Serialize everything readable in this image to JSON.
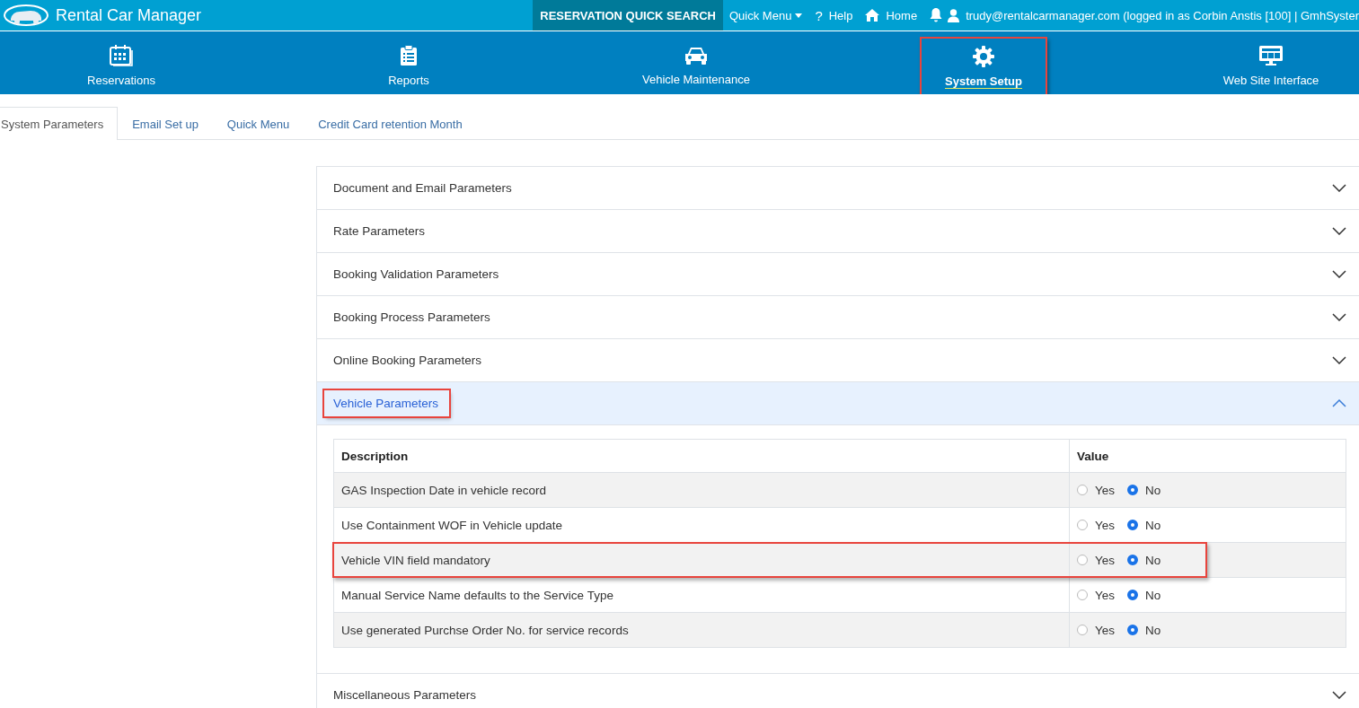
{
  "top_bar": {
    "app_title": "Rental Car Manager",
    "quick_search": "RESERVATION QUICK SEARCH",
    "links": [
      {
        "kind": "menu",
        "label": "Quick Menu"
      },
      {
        "kind": "help",
        "icon": "?",
        "label": "Help"
      },
      {
        "kind": "home",
        "label": "Home"
      },
      {
        "kind": "bell"
      },
      {
        "kind": "user",
        "label": "trudy@rentalcarmanager.com (logged in as Corbin Anstis [100] | GmhSyster"
      }
    ]
  },
  "nav": [
    {
      "kind": "calendar",
      "label": "Reservations",
      "selected": false,
      "highlighted": false
    },
    {
      "kind": "clipboard",
      "label": "Reports",
      "selected": false,
      "highlighted": false
    },
    {
      "kind": "car",
      "label": "Vehicle Maintenance",
      "selected": false,
      "highlighted": false
    },
    {
      "kind": "gear",
      "label": "System Setup",
      "selected": true,
      "highlighted": true
    },
    {
      "kind": "monitor",
      "label": "Web Site Interface",
      "selected": false,
      "highlighted": false
    }
  ],
  "tabs": [
    {
      "label": "System Parameters",
      "selected": true
    },
    {
      "label": "Email Set up",
      "selected": false
    },
    {
      "label": "Quick Menu",
      "selected": false
    },
    {
      "label": "Credit Card retention Month",
      "selected": false
    }
  ],
  "sections": [
    {
      "title": "Document and Email Parameters",
      "expanded": false,
      "highlighted": false
    },
    {
      "title": "Rate Parameters",
      "expanded": false,
      "highlighted": false
    },
    {
      "title": "Booking Validation Parameters",
      "expanded": false,
      "highlighted": false
    },
    {
      "title": "Booking Process Parameters",
      "expanded": false,
      "highlighted": false
    },
    {
      "title": "Online Booking Parameters",
      "expanded": false,
      "highlighted": false
    },
    {
      "title": "Vehicle Parameters",
      "expanded": true,
      "highlighted": true,
      "table": {
        "columns": [
          "Description",
          "Value"
        ],
        "rows": [
          {
            "description": "GAS Inspection Date in vehicle record",
            "options": [
              {
                "label": "Yes",
                "selected": false
              },
              {
                "label": "No",
                "selected": true
              }
            ],
            "highlighted": false
          },
          {
            "description": "Use Containment WOF in Vehicle update",
            "options": [
              {
                "label": "Yes",
                "selected": false
              },
              {
                "label": "No",
                "selected": true
              }
            ],
            "highlighted": false
          },
          {
            "description": "Vehicle VIN field mandatory",
            "options": [
              {
                "label": "Yes",
                "selected": false
              },
              {
                "label": "No",
                "selected": true
              }
            ],
            "highlighted": true
          },
          {
            "description": "Manual Service Name defaults to the Service Type",
            "options": [
              {
                "label": "Yes",
                "selected": false
              },
              {
                "label": "No",
                "selected": true
              }
            ],
            "highlighted": false
          },
          {
            "description": "Use generated Purchse Order No. for service records",
            "options": [
              {
                "label": "Yes",
                "selected": false
              },
              {
                "label": "No",
                "selected": true
              }
            ],
            "highlighted": false
          }
        ]
      }
    },
    {
      "title": "Miscellaneous Parameters",
      "expanded": false,
      "highlighted": false
    }
  ]
}
